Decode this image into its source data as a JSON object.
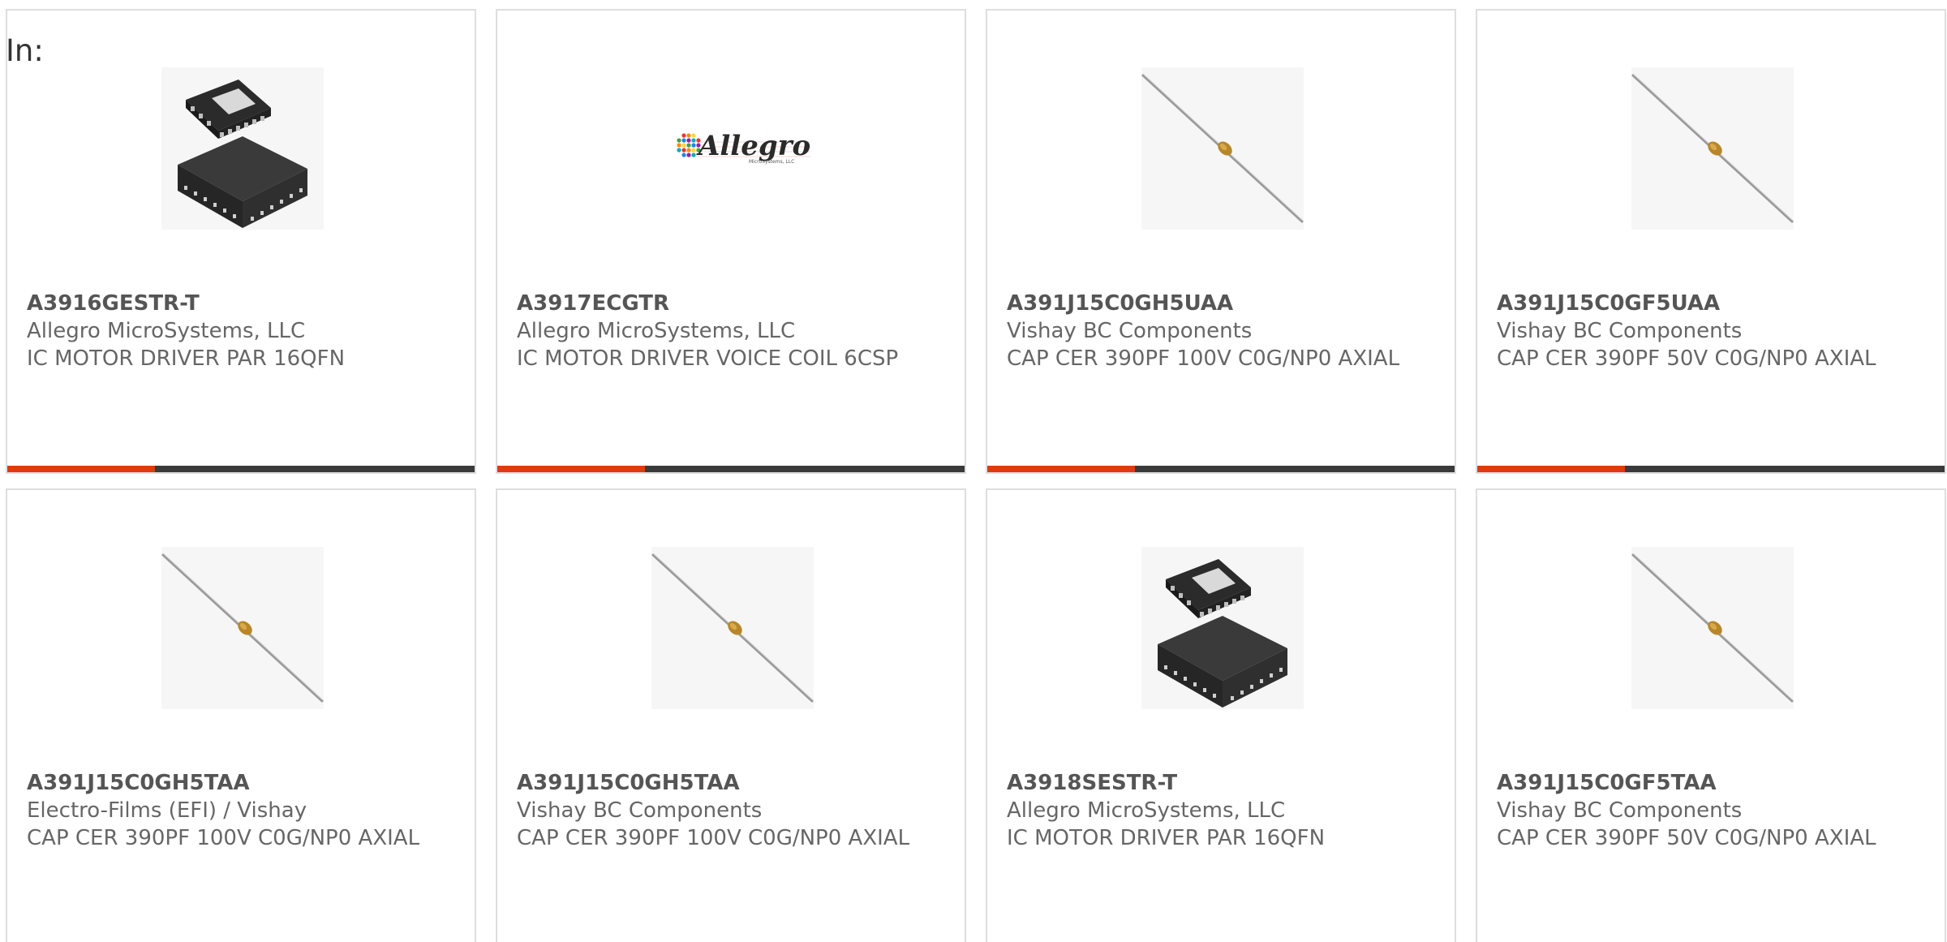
{
  "filter": {
    "label": "In:"
  },
  "products": [
    {
      "part_number": "A3916GESTR-T",
      "manufacturer": "Allegro MicroSystems, LLC",
      "description": "IC MOTOR DRIVER PAR 16QFN",
      "image": "qfn-chip-icon"
    },
    {
      "part_number": "A3917ECGTR",
      "manufacturer": "Allegro MicroSystems, LLC",
      "description": "IC MOTOR DRIVER VOICE COIL 6CSP",
      "image": "allegro-logo",
      "logo_text": "Allegro",
      "logo_subtext": "MicroSystems, LLC"
    },
    {
      "part_number": "A391J15C0GH5UAA",
      "manufacturer": "Vishay BC Components",
      "description": "CAP CER 390PF 100V C0G/NP0 AXIAL",
      "image": "axial-capacitor-icon"
    },
    {
      "part_number": "A391J15C0GF5UAA",
      "manufacturer": "Vishay BC Components",
      "description": "CAP CER 390PF 50V C0G/NP0 AXIAL",
      "image": "axial-capacitor-icon"
    },
    {
      "part_number": "A391J15C0GH5TAA",
      "manufacturer": "Electro-Films (EFI) / Vishay",
      "description": "CAP CER 390PF 100V C0G/NP0 AXIAL",
      "image": "axial-capacitor-icon"
    },
    {
      "part_number": "A391J15C0GH5TAA",
      "manufacturer": "Vishay BC Components",
      "description": "CAP CER 390PF 100V C0G/NP0 AXIAL",
      "image": "axial-capacitor-icon"
    },
    {
      "part_number": "A3918SESTR-T",
      "manufacturer": "Allegro MicroSystems, LLC",
      "description": "IC MOTOR DRIVER PAR 16QFN",
      "image": "qfn-chip-icon"
    },
    {
      "part_number": "A391J15C0GF5TAA",
      "manufacturer": "Vishay BC Components",
      "description": "CAP CER 390PF 50V C0G/NP0 AXIAL",
      "image": "axial-capacitor-icon"
    }
  ],
  "colors": {
    "accent": "#e03a0f",
    "bar": "#3a3a3a",
    "border": "#dedede",
    "text": "#666666"
  }
}
